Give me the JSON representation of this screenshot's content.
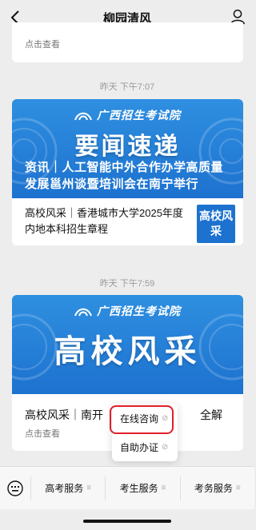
{
  "header": {
    "title": "柳园清风"
  },
  "top_card": {
    "link_text": "点击查看"
  },
  "messages": [
    {
      "timestamp": "昨天 下午7:07",
      "banner": {
        "logo_text": "广西招生考试院",
        "big_text": "要闻速递",
        "headline": "资讯｜人工智能中外合作办学高质量发展邕州谈暨培训会在南宁举行"
      },
      "second_article": {
        "title": "高校风采｜香港城市大学2025年度内地本科招生章程",
        "thumb_text": "高校风采"
      }
    },
    {
      "timestamp": "昨天 下午7:59",
      "banner": {
        "logo_text": "广西招生考试院",
        "big_text": "高校风采"
      },
      "article": {
        "title_left": "高校风采｜南开",
        "title_right": "全解",
        "link_text": "点击查看"
      }
    }
  ],
  "popup": {
    "items": [
      {
        "label": "在线咨询",
        "highlighted": true
      },
      {
        "label": "自助办证",
        "highlighted": false
      }
    ]
  },
  "bottom_menu": {
    "items": [
      {
        "label": "高考服务"
      },
      {
        "label": "考生服务"
      },
      {
        "label": "考务服务"
      }
    ]
  },
  "colors": {
    "accent_blue": "#1d72cf",
    "highlight_red": "#e0202a"
  }
}
